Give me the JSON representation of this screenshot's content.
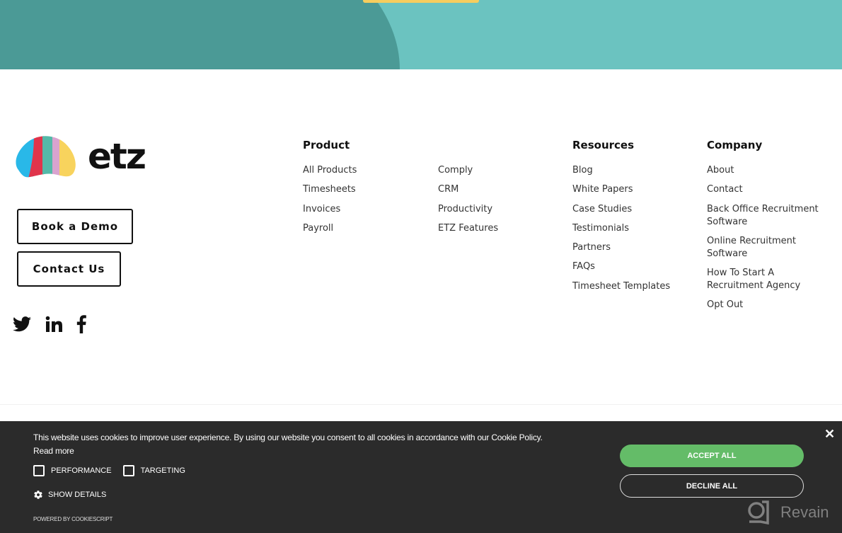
{
  "hero": {
    "colors": {
      "dark": "#4b9a96",
      "light": "#6bc3c0",
      "cta": "#f6cd5e"
    }
  },
  "brand": {
    "name": "etz",
    "logo_colors": [
      "#29b8e8",
      "#e0344b",
      "#54b9a8",
      "#d9a3cf",
      "#f8d35d"
    ]
  },
  "cta": {
    "book_demo": "Book a Demo",
    "contact_us": "Contact Us"
  },
  "social": [
    "twitter-icon",
    "linkedin-icon",
    "facebook-icon"
  ],
  "columns": {
    "product": {
      "title": "Product",
      "items": [
        "All Products",
        "Timesheets",
        "Invoices",
        "Payroll"
      ],
      "items2": [
        "Comply",
        "CRM",
        "Productivity",
        "ETZ Features"
      ]
    },
    "resources": {
      "title": "Resources",
      "items": [
        "Blog",
        "White Papers",
        "Case Studies",
        "Testimonials",
        "Partners",
        "FAQs",
        "Timesheet Templates"
      ]
    },
    "company": {
      "title": "Company",
      "items": [
        "About",
        "Contact",
        "Back Office Recruitment Software",
        "Online Recruitment Software",
        "How To Start A Recruitment Agency",
        "Opt Out"
      ]
    }
  },
  "cookie": {
    "message": "This website uses cookies to improve user experience. By using our website you consent to all cookies in accordance with our Cookie Policy.",
    "read_more": "Read more",
    "checkbox_performance": "PERFORMANCE",
    "checkbox_targeting": "TARGETING",
    "show_details": "SHOW DETAILS",
    "powered_by": "POWERED BY COOKIESCRIPT",
    "accept_all": "ACCEPT ALL",
    "decline_all": "DECLINE ALL",
    "close": "✕",
    "accept_color": "#64bc68",
    "background": "#2b2b2b"
  },
  "watermark": {
    "text": "Revain"
  }
}
